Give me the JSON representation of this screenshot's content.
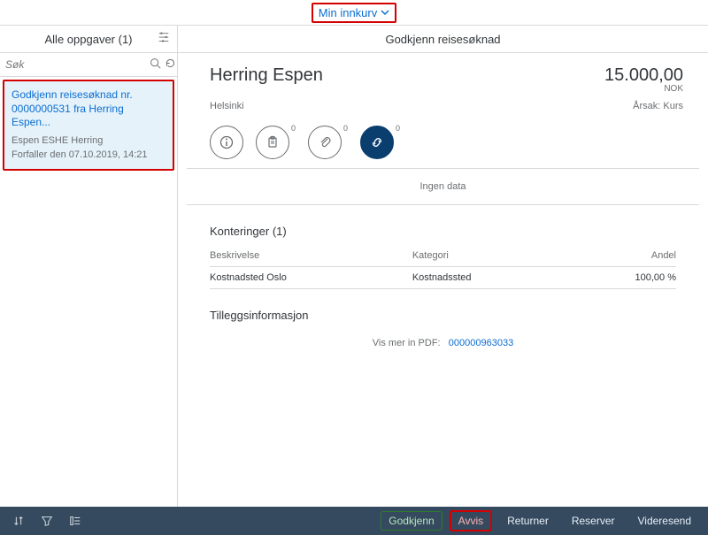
{
  "shell": {
    "inbox_label": "Min innkurv"
  },
  "master": {
    "title": "Alle oppgaver (1)",
    "search_placeholder": "Søk",
    "task": {
      "title": "Godkjenn reisesøknad nr. 0000000531 fra Herring Espen...",
      "subtitle": "Espen ESHE Herring",
      "due": "Forfaller den 07.10.2019, 14:21"
    }
  },
  "detail": {
    "page_title": "Godkjenn reisesøknad",
    "name": "Herring Espen",
    "amount": "15.000,00",
    "currency": "NOK",
    "location": "Helsinki",
    "reason_label": "Årsak: Kurs",
    "tabs": {
      "info_badge": "",
      "checklist_badge": "0",
      "attach_badge": "0",
      "link_badge": "0"
    },
    "nodata": "Ingen data",
    "konteringer": {
      "title": "Konteringer (1)",
      "headers": {
        "desc": "Beskrivelse",
        "cat": "Kategori",
        "share": "Andel"
      },
      "rows": [
        {
          "desc": "Kostnadsted Oslo",
          "cat": "Kostnadssted",
          "share": "100,00 %"
        }
      ]
    },
    "extra": {
      "title": "Tilleggsinformasjon",
      "pdf_label": "Vis mer in PDF:",
      "pdf_link": "000000963033"
    }
  },
  "footer": {
    "approve": "Godkjenn",
    "reject": "Avvis",
    "return": "Returner",
    "reserve": "Reserver",
    "forward": "Videresend"
  }
}
